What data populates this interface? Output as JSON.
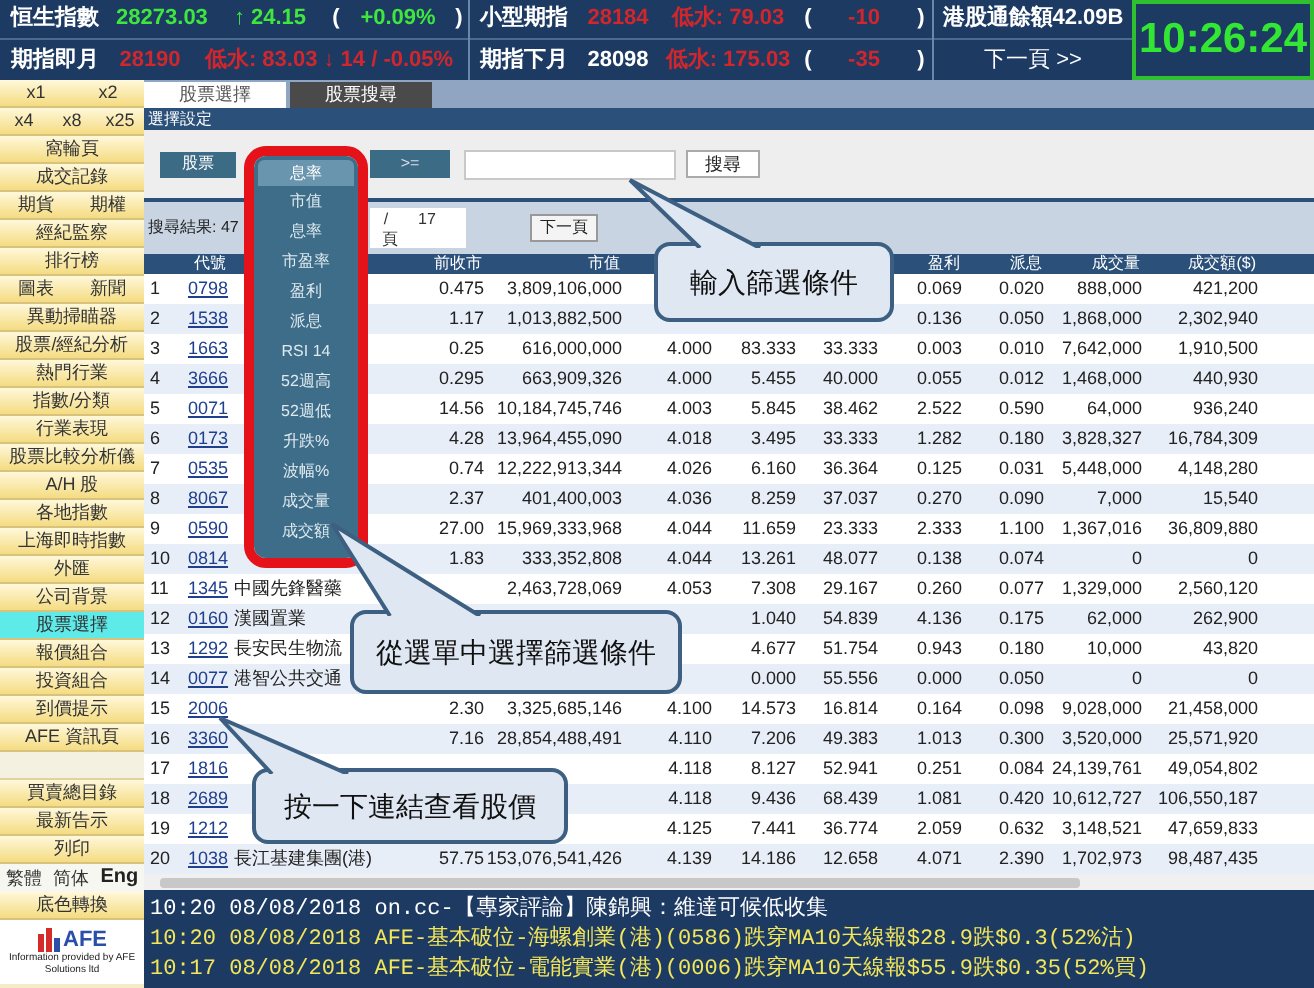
{
  "top_bar": {
    "lines": [
      {
        "segments": [
          {
            "text": "恒生指數",
            "color": "#ffffff"
          },
          {
            "text": "28273.03",
            "color": "#3ee63e"
          },
          {
            "text": "↑ 24.15",
            "color": "#3ee63e"
          },
          {
            "text": "(",
            "color": "#ffffff"
          },
          {
            "text": "+0.09%",
            "color": "#3ee63e"
          },
          {
            "text": ")",
            "color": "#ffffff"
          },
          {
            "text": "小型期指",
            "color": "#ffffff"
          },
          {
            "text": "28184",
            "color": "#d0262c"
          },
          {
            "text": "低水: 79.03",
            "color": "#d0262c"
          },
          {
            "text": "(",
            "color": "#ffffff"
          },
          {
            "text": "-10",
            "color": "#d0262c"
          },
          {
            "text": ")",
            "color": "#ffffff"
          },
          {
            "text": "港股通餘額42.09B",
            "color": "#ffffff"
          }
        ]
      },
      {
        "segments": [
          {
            "text": "期指即月",
            "color": "#ffffff"
          },
          {
            "text": "28190",
            "color": "#d0262c"
          },
          {
            "text": "低水: 83.03 ↓ 14 / -0.05%",
            "color": "#d0262c"
          },
          {
            "text": "期指下月",
            "color": "#ffffff"
          },
          {
            "text": "28098",
            "color": "#ffffff"
          },
          {
            "text": "低水: 175.03",
            "color": "#d0262c"
          },
          {
            "text": "(",
            "color": "#ffffff"
          },
          {
            "text": "-35",
            "color": "#d0262c"
          },
          {
            "text": ")",
            "color": "#ffffff"
          }
        ],
        "link": "下一頁 >>"
      }
    ],
    "clock": "10:26:24"
  },
  "sidebar": {
    "rows": [
      {
        "kind": "buttons",
        "items": [
          {
            "label": "x1",
            "selected": false
          },
          {
            "label": "x2",
            "selected": false
          }
        ]
      },
      {
        "kind": "buttons",
        "items": [
          {
            "label": "x4",
            "selected": false
          },
          {
            "label": "x8",
            "selected": false
          },
          {
            "label": "x25",
            "selected": false
          }
        ]
      },
      {
        "kind": "buttons",
        "items": [
          {
            "label": "窩輪頁",
            "selected": false
          }
        ]
      },
      {
        "kind": "buttons",
        "items": [
          {
            "label": "成交記錄",
            "selected": false
          }
        ]
      },
      {
        "kind": "buttons",
        "items": [
          {
            "label": "期貨",
            "selected": false
          },
          {
            "label": "期權",
            "selected": false
          }
        ]
      },
      {
        "kind": "buttons",
        "items": [
          {
            "label": "經紀監察",
            "selected": false
          }
        ]
      },
      {
        "kind": "buttons",
        "items": [
          {
            "label": "排行榜",
            "selected": false
          }
        ]
      },
      {
        "kind": "buttons",
        "items": [
          {
            "label": "圖表",
            "selected": false
          },
          {
            "label": "新聞",
            "selected": false
          }
        ]
      },
      {
        "kind": "buttons",
        "items": [
          {
            "label": "異動掃瞄器",
            "selected": false
          }
        ]
      },
      {
        "kind": "buttons",
        "items": [
          {
            "label": "股票/經紀分析",
            "selected": false
          }
        ]
      },
      {
        "kind": "buttons",
        "items": [
          {
            "label": "熱門行業",
            "selected": false
          }
        ]
      },
      {
        "kind": "buttons",
        "items": [
          {
            "label": "指數/分類",
            "selected": false
          }
        ]
      },
      {
        "kind": "buttons",
        "items": [
          {
            "label": "行業表現",
            "selected": false
          }
        ]
      },
      {
        "kind": "buttons",
        "items": [
          {
            "label": "股票比較分析儀",
            "selected": false
          }
        ]
      },
      {
        "kind": "buttons",
        "items": [
          {
            "label": "A/H 股",
            "selected": false
          }
        ]
      },
      {
        "kind": "buttons",
        "items": [
          {
            "label": "各地指數",
            "selected": false
          }
        ]
      },
      {
        "kind": "buttons",
        "items": [
          {
            "label": "上海即時指數",
            "selected": false
          }
        ]
      },
      {
        "kind": "buttons",
        "items": [
          {
            "label": "外匯",
            "selected": false
          }
        ]
      },
      {
        "kind": "buttons",
        "items": [
          {
            "label": "公司背景",
            "selected": false
          }
        ]
      },
      {
        "kind": "buttons",
        "items": [
          {
            "label": "股票選擇",
            "selected": true
          }
        ]
      },
      {
        "kind": "buttons",
        "items": [
          {
            "label": "報價組合",
            "selected": false
          }
        ]
      },
      {
        "kind": "buttons",
        "items": [
          {
            "label": "投資組合",
            "selected": false
          }
        ]
      },
      {
        "kind": "buttons",
        "items": [
          {
            "label": "到價提示",
            "selected": false
          }
        ]
      },
      {
        "kind": "buttons",
        "items": [
          {
            "label": "AFE 資訊頁",
            "selected": false
          }
        ]
      },
      {
        "kind": "spacer"
      },
      {
        "kind": "buttons",
        "items": [
          {
            "label": "買賣總目錄",
            "selected": false
          }
        ]
      },
      {
        "kind": "buttons",
        "items": [
          {
            "label": "最新告示",
            "selected": false
          }
        ]
      },
      {
        "kind": "buttons",
        "items": [
          {
            "label": "列印",
            "selected": false
          }
        ]
      },
      {
        "kind": "languages",
        "items": [
          {
            "label": "繁體",
            "selected": false
          },
          {
            "label": "简体",
            "selected": false
          },
          {
            "label": "Eng",
            "selected": false
          }
        ]
      }
    ],
    "color_toggle": "底色轉換",
    "logo": {
      "name": "AFE",
      "credit": "Information provided by AFE Solutions ltd"
    }
  },
  "tabs": [
    {
      "label": "股票選擇",
      "selected": true
    },
    {
      "label": "股票搜尋",
      "selected": false
    }
  ],
  "section_title": "選擇設定",
  "filter": {
    "market": "股票",
    "operator": ">=",
    "search_button": "搜尋"
  },
  "results": {
    "summary": "搜尋結果: 47",
    "page_separator": "/",
    "page_total": "17",
    "page_unit": "頁",
    "next_button": "下一頁"
  },
  "table": {
    "columns": [
      null,
      "代號",
      null,
      "前收市",
      "市值",
      null,
      null,
      null,
      "盈利",
      "派息",
      "成交量",
      "成交額($)"
    ],
    "rows": [
      {
        "cells": [
          "1",
          "0798",
          null,
          "0.475",
          "3,809,106,000",
          null,
          null,
          null,
          "0.069",
          "0.020",
          "888,000",
          "421,200"
        ]
      },
      {
        "cells": [
          "2",
          "1538",
          null,
          "1.17",
          "1,013,882,500",
          null,
          null,
          null,
          "0.136",
          "0.050",
          "1,868,000",
          "2,302,940"
        ]
      },
      {
        "cells": [
          "3",
          "1663",
          null,
          "0.25",
          "616,000,000",
          "4.000",
          "83.333",
          "33.333",
          "0.003",
          "0.010",
          "7,642,000",
          "1,910,500"
        ]
      },
      {
        "cells": [
          "4",
          "3666",
          null,
          "0.295",
          "663,909,326",
          "4.000",
          "5.455",
          "40.000",
          "0.055",
          "0.012",
          "1,468,000",
          "440,930"
        ]
      },
      {
        "cells": [
          "5",
          "0071",
          null,
          "14.56",
          "10,184,745,746",
          "4.003",
          "5.845",
          "38.462",
          "2.522",
          "0.590",
          "64,000",
          "936,240"
        ]
      },
      {
        "cells": [
          "6",
          "0173",
          null,
          "4.28",
          "13,964,455,090",
          "4.018",
          "3.495",
          "33.333",
          "1.282",
          "0.180",
          "3,828,327",
          "16,784,309"
        ]
      },
      {
        "cells": [
          "7",
          "0535",
          null,
          "0.74",
          "12,222,913,344",
          "4.026",
          "6.160",
          "36.364",
          "0.125",
          "0.031",
          "5,448,000",
          "4,148,280"
        ]
      },
      {
        "cells": [
          "8",
          "8067",
          null,
          "2.37",
          "401,400,003",
          "4.036",
          "8.259",
          "37.037",
          "0.270",
          "0.090",
          "7,000",
          "15,540"
        ]
      },
      {
        "cells": [
          "9",
          "0590",
          null,
          "27.00",
          "15,969,333,968",
          "4.044",
          "11.659",
          "23.333",
          "2.333",
          "1.100",
          "1,367,016",
          "36,809,880"
        ]
      },
      {
        "cells": [
          "10",
          "0814",
          null,
          "1.83",
          "333,352,808",
          "4.044",
          "13.261",
          "48.077",
          "0.138",
          "0.074",
          "0",
          "0"
        ]
      },
      {
        "cells": [
          "11",
          "1345",
          "中國先鋒醫藥",
          null,
          "2,463,728,069",
          "4.053",
          "7.308",
          "29.167",
          "0.260",
          "0.077",
          "1,329,000",
          "2,560,120"
        ]
      },
      {
        "cells": [
          "12",
          "0160",
          "漢國置業",
          null,
          null,
          null,
          "1.040",
          "54.839",
          "4.136",
          "0.175",
          "62,000",
          "262,900"
        ]
      },
      {
        "cells": [
          "13",
          "1292",
          "長安民生物流",
          null,
          null,
          null,
          "4.677",
          "51.754",
          "0.943",
          "0.180",
          "10,000",
          "43,820"
        ]
      },
      {
        "cells": [
          "14",
          "0077",
          "港智公共交通",
          null,
          null,
          null,
          "0.000",
          "55.556",
          "0.000",
          "0.050",
          "0",
          "0"
        ]
      },
      {
        "cells": [
          "15",
          "2006",
          null,
          "2.30",
          "3,325,685,146",
          "4.100",
          "14.573",
          "16.814",
          "0.164",
          "0.098",
          "9,028,000",
          "21,458,000"
        ]
      },
      {
        "cells": [
          "16",
          "3360",
          null,
          "7.16",
          "28,854,488,491",
          "4.110",
          "7.206",
          "49.383",
          "1.013",
          "0.300",
          "3,520,000",
          "25,571,920"
        ]
      },
      {
        "cells": [
          "17",
          "1816",
          null,
          null,
          null,
          "4.118",
          "8.127",
          "52.941",
          "0.251",
          "0.084",
          "24,139,761",
          "49,054,802"
        ]
      },
      {
        "cells": [
          "18",
          "2689",
          null,
          null,
          null,
          "4.118",
          "9.436",
          "68.439",
          "1.081",
          "0.420",
          "10,612,727",
          "106,550,187"
        ]
      },
      {
        "cells": [
          "19",
          "1212",
          null,
          null,
          null,
          "4.125",
          "7.441",
          "36.774",
          "2.059",
          "0.632",
          "3,148,521",
          "47,659,833"
        ]
      },
      {
        "cells": [
          "20",
          "1038",
          "長江基建集團(港)",
          "57.75",
          "153,076,541,426",
          "4.139",
          "14.186",
          "12.658",
          "4.071",
          "2.390",
          "1,702,973",
          "98,487,435"
        ]
      }
    ]
  },
  "ticker": [
    {
      "text": "10:20 08/08/2018 on.cc-【專家評論】陳錦興：維達可候低收集",
      "color": "#ffffff"
    },
    {
      "text": "10:20 08/08/2018 AFE-基本破位-海螺創業(港)(0586)跌穿MA10天線報$28.9跌$0.3(52%沽)",
      "color": "#f2e65a"
    },
    {
      "text": "10:17 08/08/2018 AFE-基本破位-電能實業(港)(0006)跌穿MA10天線報$55.9跌$0.35(52%買)",
      "color": "#f2e65a"
    }
  ],
  "dropdown": {
    "value": "息率",
    "options": [
      "市值",
      "息率",
      "市盈率",
      "盈利",
      "派息",
      "RSI 14",
      "52週高",
      "52週低",
      "升跌%",
      "波幅%",
      "成交量",
      "成交額"
    ]
  },
  "callouts": [
    {
      "text": "輸入篩選條件"
    },
    {
      "text": "從選單中選擇篩選條件"
    },
    {
      "text": "按一下連結查看股價"
    }
  ]
}
